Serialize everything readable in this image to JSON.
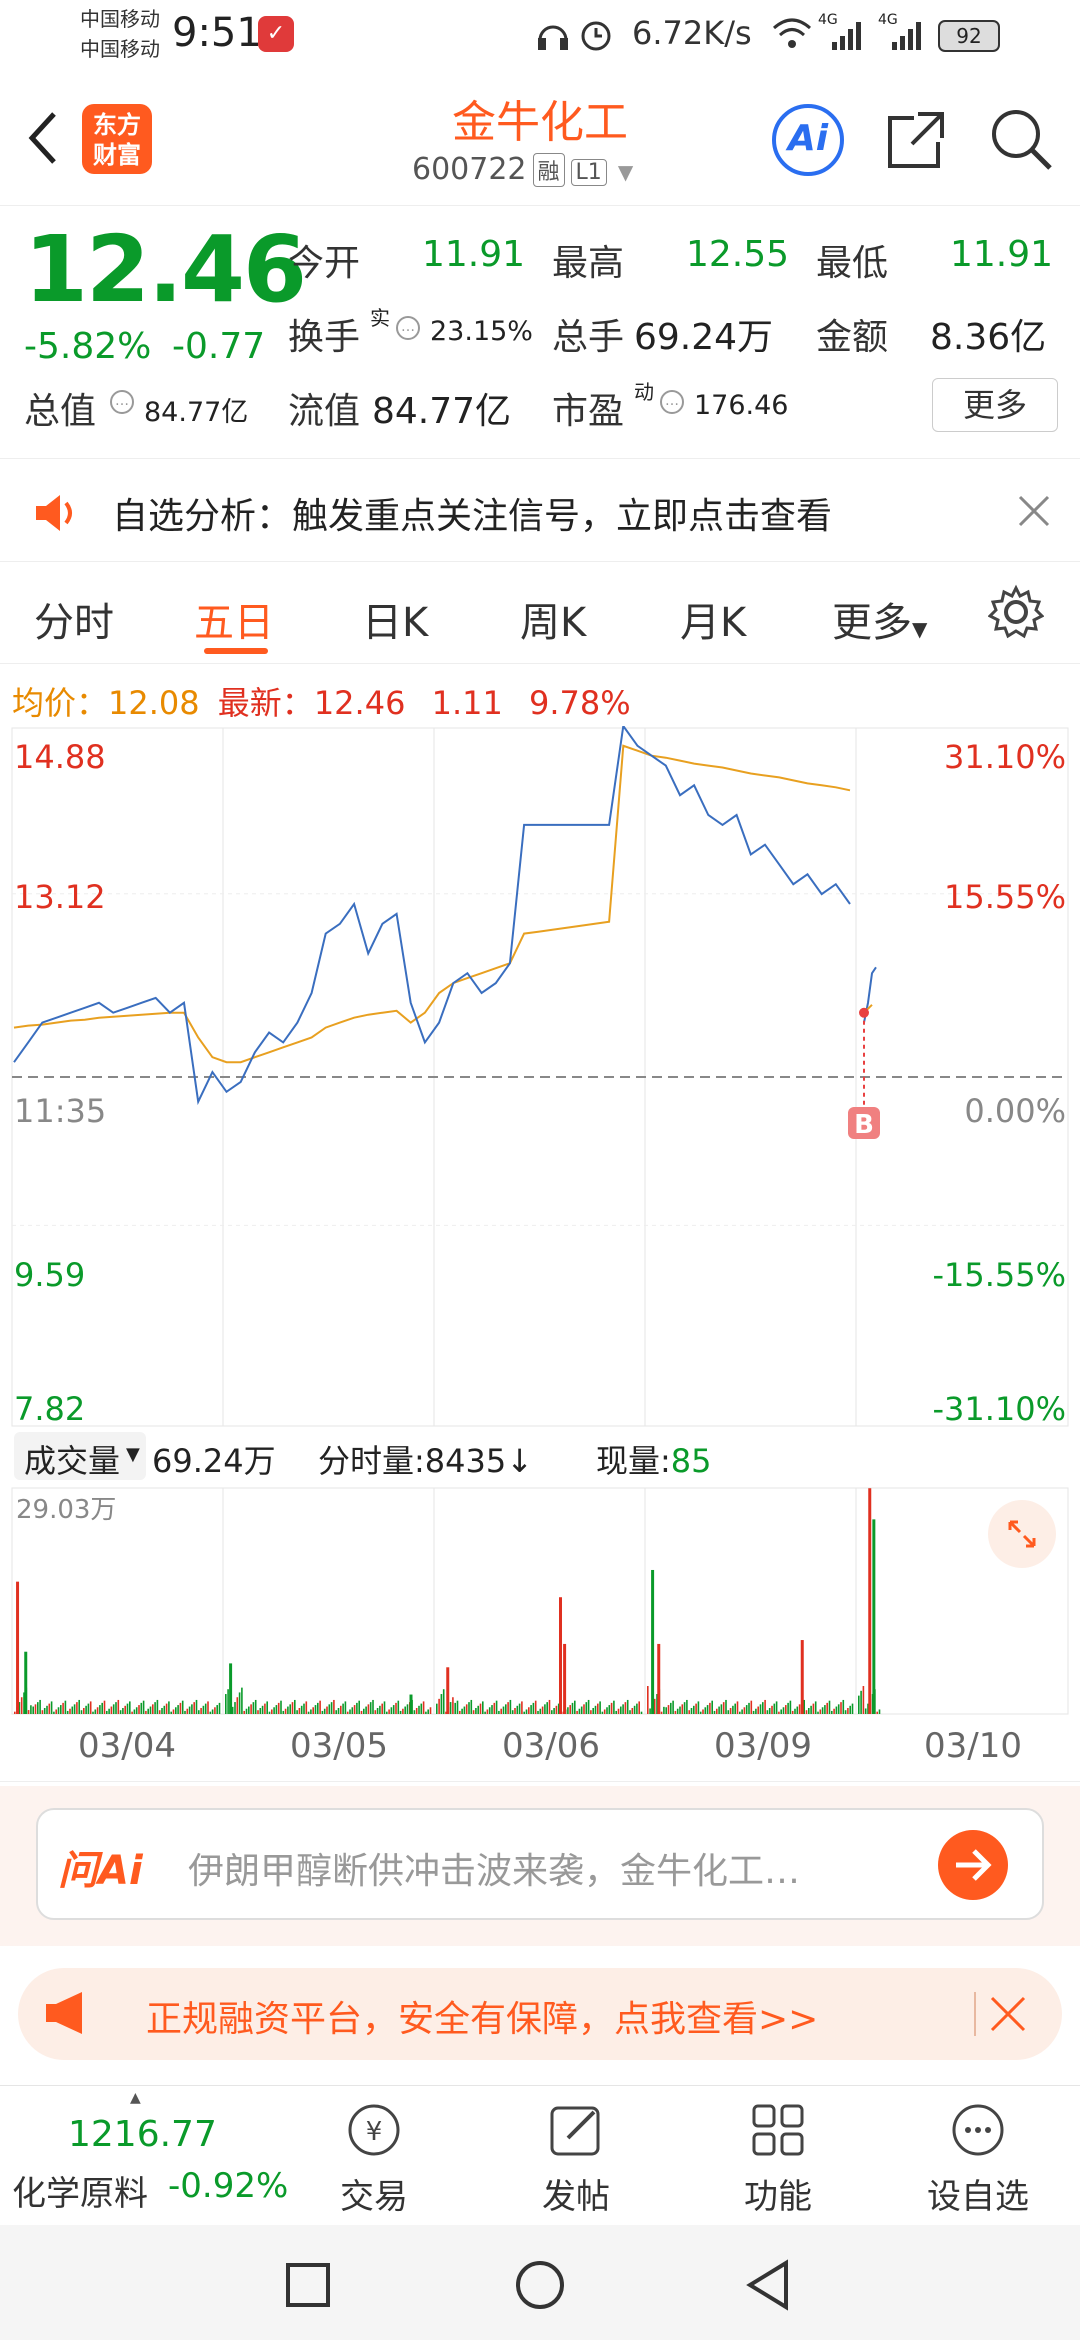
{
  "status": {
    "carrier1": "中国移动",
    "carrier2": "中国移动",
    "time": "9:51",
    "speed": "6.72K/s",
    "net1": "4G",
    "net2": "4G",
    "battery": "92"
  },
  "header": {
    "logo_line1": "东方",
    "logo_line2": "财富",
    "stock_name": "金牛化工",
    "stock_code": "600722",
    "tag_rong": "融",
    "tag_level": "L1",
    "ai_label": "Ai"
  },
  "quote": {
    "price": "12.46",
    "pct_change": "-5.82%",
    "change": "-0.77",
    "open_label": "今开",
    "open_value": "11.91",
    "high_label": "最高",
    "high_value": "12.55",
    "low_label": "最低",
    "low_value": "11.91",
    "turnover_label": "换手",
    "turnover_sup": "实",
    "turnover_value": "23.15%",
    "volume_label": "总手",
    "volume_value": "69.24万",
    "amount_label": "金额",
    "amount_value": "8.36亿",
    "mcap_label": "总值",
    "mcap_value": "84.77亿",
    "float_label": "流值",
    "float_value": "84.77亿",
    "pe_label": "市盈",
    "pe_sup": "动",
    "pe_value": "176.46",
    "more_label": "更多"
  },
  "notice": {
    "text": "自选分析：触发重点关注信号，立即点击查看"
  },
  "tabs": [
    {
      "label": "分时"
    },
    {
      "label": "五日"
    },
    {
      "label": "日K"
    },
    {
      "label": "周K"
    },
    {
      "label": "月K"
    },
    {
      "label": "更多"
    }
  ],
  "chart_info": {
    "avg_label": "均价：",
    "avg_value": "12.08",
    "latest_label": "最新：",
    "latest_value": "12.46",
    "latest_change": "1.11",
    "latest_pct": "9.78%",
    "volume_label": "成交量",
    "volume_total": "69.24万",
    "minute_vol_label": "分时量:",
    "minute_vol_value": "8435",
    "now_vol_label": "现量:",
    "now_vol_value": "85",
    "vol_max_label": "29.03万",
    "marker_b": "B"
  },
  "chart_data": [
    {
      "type": "line",
      "y_ticks_left": [
        "14.88",
        "13.12",
        "11:35",
        "9.59",
        "7.82"
      ],
      "y_ticks_right": [
        "31.10%",
        "15.55%",
        "0.00%",
        "-15.55%",
        "-31.10%"
      ],
      "ylim": [
        7.82,
        14.88
      ],
      "reference": 11.35,
      "categories": [
        "03/04",
        "03/05",
        "03/06",
        "03/09",
        "03/10"
      ],
      "series": [
        {
          "values": [
            11.5,
            11.7,
            11.9,
            11.95,
            12.0,
            12.05,
            12.1,
            12.0,
            12.05,
            12.1,
            12.15,
            12.0,
            12.1,
            11.1,
            11.4,
            11.2,
            11.3,
            11.6,
            11.8,
            11.7,
            11.9,
            12.2,
            12.8,
            12.9,
            13.1,
            12.6,
            12.9,
            13.0,
            12.1,
            11.7,
            11.9,
            12.3,
            12.4,
            12.2,
            12.3,
            12.5,
            13.9,
            13.9,
            13.9,
            13.9,
            13.9,
            13.9,
            13.9,
            14.9,
            14.7,
            14.6,
            14.5,
            14.2,
            14.3,
            14.0,
            13.9,
            14.0,
            13.6,
            13.7,
            13.5,
            13.3,
            13.4,
            13.2,
            13.3,
            13.1
          ],
          "today": [
            11.9,
            12.1,
            12.4,
            12.46
          ]
        },
        {
          "values": [
            11.85,
            11.87,
            11.88,
            11.9,
            11.92,
            11.93,
            11.95,
            11.96,
            11.97,
            11.98,
            11.99,
            12.0,
            12.0,
            11.75,
            11.55,
            11.5,
            11.5,
            11.55,
            11.6,
            11.65,
            11.7,
            11.75,
            11.85,
            11.9,
            11.95,
            11.98,
            12.0,
            12.02,
            11.9,
            12.0,
            12.2,
            12.3,
            12.35,
            12.4,
            12.45,
            12.5,
            12.8,
            12.82,
            12.84,
            12.86,
            12.88,
            12.9,
            12.92,
            14.7,
            14.65,
            14.6,
            14.58,
            14.55,
            14.52,
            14.5,
            14.48,
            14.45,
            14.42,
            14.4,
            14.38,
            14.35,
            14.32,
            14.3,
            14.28,
            14.25
          ],
          "today": [
            12.0,
            12.08
          ]
        }
      ]
    },
    {
      "type": "bar",
      "ylim": [
        0,
        29.03
      ],
      "days": 5,
      "peaks": [
        {
          "day": 0,
          "pos": 0.01,
          "value": 17.0,
          "color": "red"
        },
        {
          "day": 0,
          "pos": 0.05,
          "value": 8.0,
          "color": "green"
        },
        {
          "day": 1,
          "pos": 0.02,
          "value": 6.5,
          "color": "green"
        },
        {
          "day": 1,
          "pos": 0.9,
          "value": 2.5,
          "color": "green"
        },
        {
          "day": 2,
          "pos": 0.05,
          "value": 6.0,
          "color": "red"
        },
        {
          "day": 2,
          "pos": 0.6,
          "value": 15.0,
          "color": "red"
        },
        {
          "day": 2,
          "pos": 0.62,
          "value": 9.0,
          "color": "red"
        },
        {
          "day": 3,
          "pos": 0.02,
          "value": 18.5,
          "color": "green"
        },
        {
          "day": 3,
          "pos": 0.05,
          "value": 9.0,
          "color": "red"
        },
        {
          "day": 3,
          "pos": 0.75,
          "value": 9.5,
          "color": "red"
        },
        {
          "day": 4,
          "pos": 0.05,
          "value": 29.0,
          "color": "red"
        },
        {
          "day": 4,
          "pos": 0.07,
          "value": 25.0,
          "color": "green"
        }
      ]
    }
  ],
  "ai_prompt": {
    "brand": "问Ai",
    "text": "伊朗甲醇断供冲击波来袭，金牛化工…"
  },
  "promo": {
    "text": "正规融资平台，安全有保障，点我查看>>"
  },
  "bottom": {
    "index_value": "1216.77",
    "index_name": "化学原料",
    "index_change": "-0.92%",
    "trade": "交易",
    "post": "发帖",
    "func": "功能",
    "watch": "设自选"
  }
}
